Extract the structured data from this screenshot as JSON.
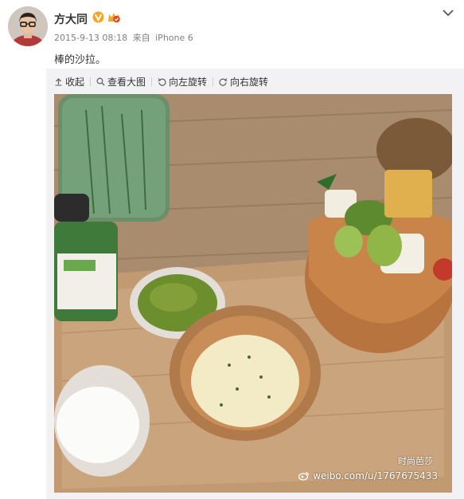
{
  "post": {
    "username": "方大同",
    "timestamp": "2015-9-13 08:18",
    "source_prefix": "来自",
    "source_device": "iPhone 6",
    "text": "棒的沙拉。"
  },
  "toolbar": {
    "collapse_label": "收起",
    "view_large_label": "查看大图",
    "rotate_left_label": "向左旋转",
    "rotate_right_label": "向右旋转"
  },
  "photo": {
    "watermark_url": "weibo.com/u/1767675433",
    "watermark_caption": "时尚芭莎"
  },
  "icons": {
    "verified": "verified-v-icon",
    "vip": "vip-badge-icon",
    "menu": "chevron-down-icon",
    "collapse": "arrow-up-icon",
    "view": "magnifier-icon",
    "rotate_left": "rotate-left-icon",
    "rotate_right": "rotate-right-icon"
  },
  "colors": {
    "accent_badge": "#f5a623",
    "vip_red": "#e3471c",
    "media_background": "#f2f2f5"
  }
}
